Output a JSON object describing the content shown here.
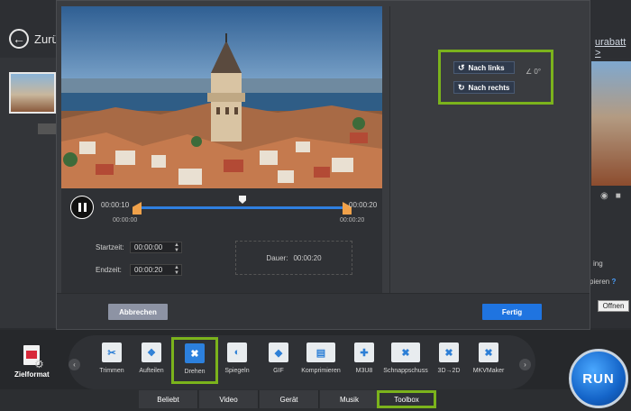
{
  "background": {
    "back_label": "Zurü",
    "right_link": "urabatt >",
    "right_text1": "ing",
    "right_text2": "pieren",
    "right_help": "?",
    "open_button": "Offnen"
  },
  "editor": {
    "timeline": {
      "current_left": "00:00:10",
      "current_right": "00:00:20",
      "start_mark": "00:00:00",
      "end_mark": "00:00:20"
    },
    "fields": {
      "start_label": "Startzeit:",
      "start_value": "00:00:00",
      "end_label": "Endzeit:",
      "end_value": "00:00:20",
      "duration_label": "Dauer:",
      "duration_value": "00:00:20"
    },
    "rotation": {
      "left_label": "Nach links",
      "right_label": "Nach rechts",
      "angle": "0°"
    },
    "footer": {
      "cancel": "Abbrechen",
      "done": "Fertig"
    }
  },
  "toolbar": {
    "format_label": "Zielformat",
    "tools": [
      {
        "label": "Trimmen",
        "icon": "scissors-icon"
      },
      {
        "label": "Aufteilen",
        "icon": "split-icon"
      },
      {
        "label": "Drehen",
        "icon": "rotate-icon"
      },
      {
        "label": "Spiegeln",
        "icon": "mirror-icon"
      },
      {
        "label": "GIF",
        "icon": "gif-icon"
      },
      {
        "label": "Komprimieren",
        "icon": "compress-icon"
      },
      {
        "label": "M3U8",
        "icon": "m3u8-icon"
      },
      {
        "label": "Schnappschuss",
        "icon": "snapshot-icon"
      },
      {
        "label": "3D→2D",
        "icon": "3d-icon"
      },
      {
        "label": "MKVMaker",
        "icon": "mkv-icon"
      }
    ],
    "selected_tool": "Drehen"
  },
  "tabs": [
    "Beliebt",
    "Video",
    "Gerät",
    "Musik",
    "Toolbox"
  ],
  "active_tab": "Toolbox",
  "run_label": "RUN",
  "colors": {
    "highlight": "#7bb31c",
    "accent_blue": "#1f74e0",
    "handle_orange": "#f0a14a"
  }
}
